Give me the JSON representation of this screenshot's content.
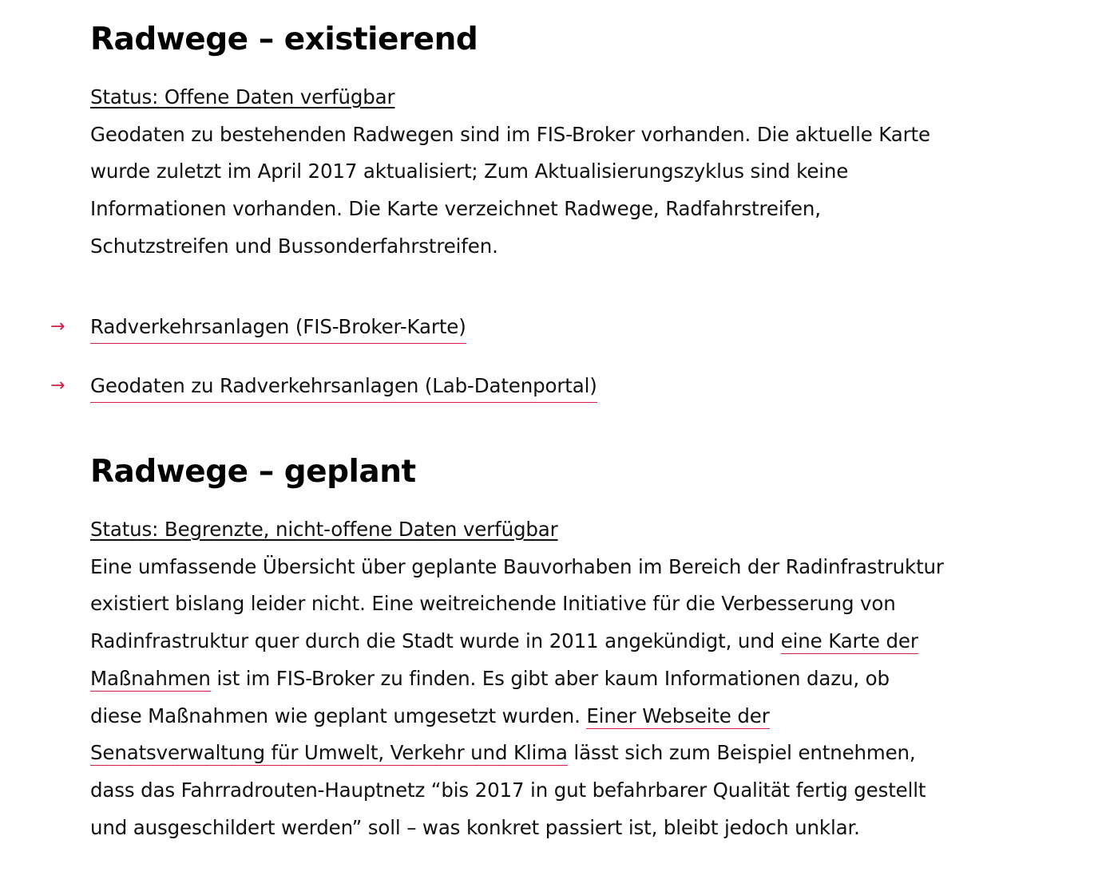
{
  "existing": {
    "heading": "Radwege – existierend",
    "status": "Status: Offene Daten verfügbar",
    "lines": [
      "Geodaten zu bestehenden Radwegen sind im FIS-Broker vorhanden. Die aktuelle Karte",
      "wurde zuletzt im April 2017 aktualisiert; Zum Aktualisierungszyklus sind keine",
      "Informationen vorhanden. Die Karte verzeichnet Radwege, Radfahrstreifen,",
      "Schutzstreifen und Bussonderfahrstreifen."
    ],
    "links": [
      {
        "arrow": "→",
        "label": "Radverkehrsanlagen (FIS-Broker-Karte)"
      },
      {
        "arrow": "→",
        "label": "Geodaten zu Radverkehrsanlagen (Lab-Datenportal)"
      }
    ]
  },
  "planned": {
    "heading": "Radwege – geplant",
    "status": "Status: Begrenzte, nicht-offene Daten verfügbar",
    "line1": "Eine umfassende Übersicht über geplante Bauvorhaben im Bereich der Radinfrastruktur",
    "line2": "existiert bislang leider nicht. Eine weitreichende Initiative für die Verbesserung von",
    "line3_pre": "Radinfrastruktur quer durch die Stadt wurde in 2011 angekündigt, und ",
    "link1_part1": "eine Karte der",
    "link1_part2": "Maßnahmen",
    "line4_post": " ist im FIS-Broker zu finden. Es gibt aber kaum Informationen dazu, ob",
    "line5_pre": "diese Maßnahmen wie geplant umgesetzt wurden. ",
    "link2_part1": "Einer Webseite der",
    "link2_part2": "Senatsverwaltung für Umwelt, Verkehr und Klima",
    "line6_post": " lässt sich zum Beispiel entnehmen,",
    "line7": "dass das Fahrradrouten-Hauptnetz “bis 2017 in gut befahrbarer Qualität fertig gestellt",
    "line8": "und ausgeschildert werden” soll – was konkret passiert ist, bleibt jedoch unklar."
  },
  "colors": {
    "accent": "#d11f4a",
    "text": "#111111",
    "background": "#ffffff"
  }
}
